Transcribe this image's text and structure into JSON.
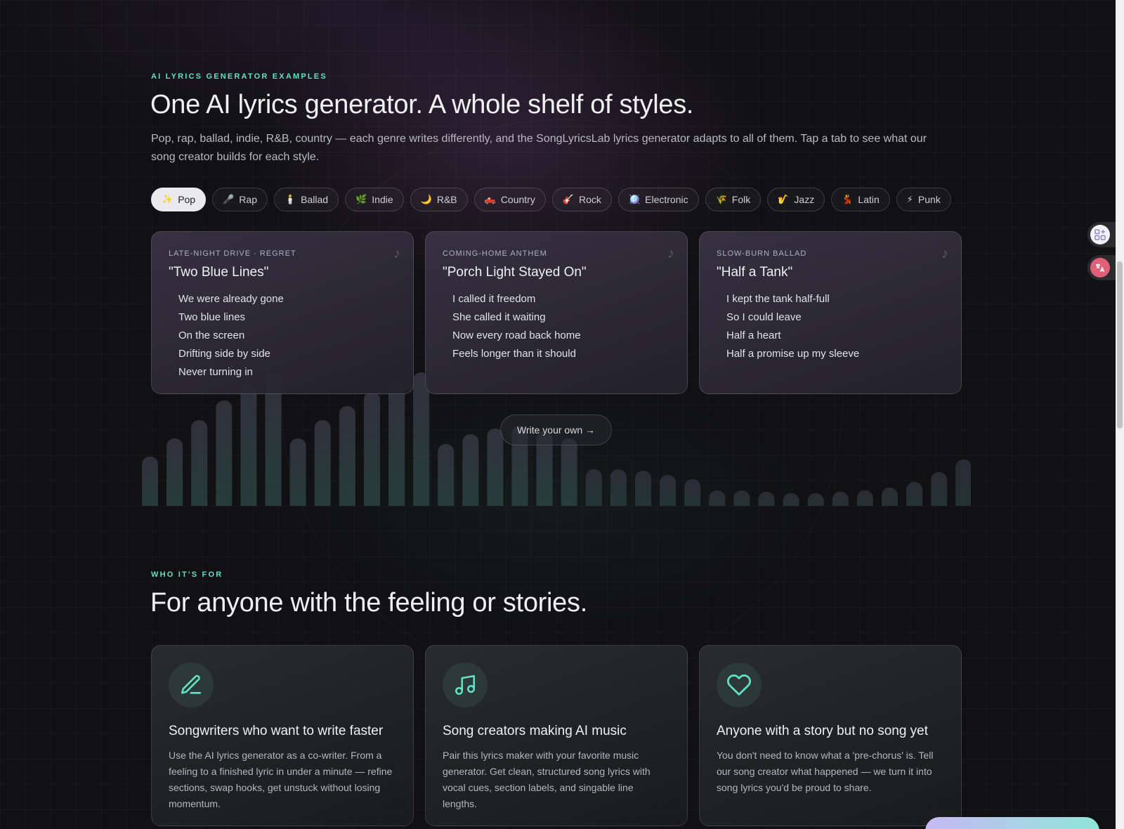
{
  "examples": {
    "eyebrow": "AI LYRICS GENERATOR EXAMPLES",
    "heading": "One AI lyrics generator. A whole shelf of styles.",
    "lead": "Pop, rap, ballad, indie, R&B, country — each genre writes differently, and the SongLyricsLab lyrics generator adapts to all of them. Tap a tab to see what our song creator builds for each style.",
    "tabs": [
      {
        "emoji": "✨",
        "label": "Pop",
        "active": true
      },
      {
        "emoji": "🎤",
        "label": "Rap"
      },
      {
        "emoji": "🕯️",
        "label": "Ballad"
      },
      {
        "emoji": "🌿",
        "label": "Indie"
      },
      {
        "emoji": "🌙",
        "label": "R&B"
      },
      {
        "emoji": "🛻",
        "label": "Country"
      },
      {
        "emoji": "🎸",
        "label": "Rock"
      },
      {
        "emoji": "🪩",
        "label": "Electronic"
      },
      {
        "emoji": "🌾",
        "label": "Folk"
      },
      {
        "emoji": "🎷",
        "label": "Jazz"
      },
      {
        "emoji": "💃",
        "label": "Latin"
      },
      {
        "emoji": "⚡",
        "label": "Punk"
      }
    ],
    "cards": [
      {
        "kicker": "LATE-NIGHT DRIVE · REGRET",
        "title": "\"Two Blue Lines\"",
        "lines": [
          "We were already gone",
          "Two blue lines",
          "On the screen",
          "Drifting side by side",
          "Never turning in"
        ]
      },
      {
        "kicker": "COMING-HOME ANTHEM",
        "title": "\"Porch Light Stayed On\"",
        "lines": [
          "I called it freedom",
          "She called it waiting",
          "Now every road back home",
          "Feels longer than it should"
        ]
      },
      {
        "kicker": "SLOW-BURN BALLAD",
        "title": "\"Half a Tank\"",
        "lines": [
          "I kept the tank half-full",
          "So I could leave",
          "Half a heart",
          "Half a promise up my sleeve"
        ]
      }
    ],
    "note_glyph": "♪",
    "write_button": "Write your own →",
    "bar_levels": [
      0.35,
      0.48,
      0.61,
      0.75,
      0.86,
      0.95,
      0.48,
      0.61,
      0.71,
      0.81,
      0.88,
      0.95,
      0.44,
      0.51,
      0.55,
      0.57,
      0.53,
      0.48,
      0.26,
      0.26,
      0.25,
      0.22,
      0.19,
      0.11,
      0.11,
      0.1,
      0.09,
      0.09,
      0.1,
      0.11,
      0.13,
      0.17,
      0.24,
      0.33
    ]
  },
  "audience": {
    "eyebrow": "WHO IT'S FOR",
    "heading": "For anyone with the feeling or stories.",
    "cards": [
      {
        "icon": "pencil-icon",
        "title": "Songwriters who want to write faster",
        "desc": "Use the AI lyrics generator as a co-writer. From a feeling to a finished lyric in under a minute — refine sections, swap hooks, get unstuck without losing momentum."
      },
      {
        "icon": "music-note-icon",
        "title": "Song creators making AI music",
        "desc": "Pair this lyrics maker with your favorite music generator. Get clean, structured song lyrics with vocal cues, section labels, and singable line lengths."
      },
      {
        "icon": "heart-icon",
        "title": "Anyone with a story but no song yet",
        "desc": "You don't need to know what a 'pre-chorus' is. Tell our song creator what happened — we turn it into song lyrics you'd be proud to share."
      }
    ]
  },
  "colors": {
    "accent": "#63e0c6",
    "background": "#111113"
  }
}
